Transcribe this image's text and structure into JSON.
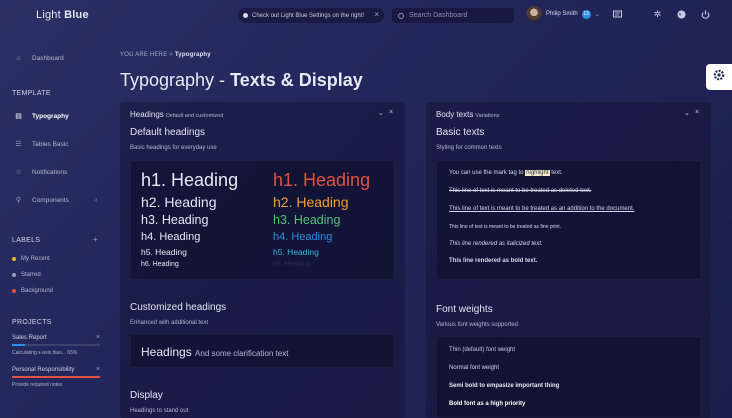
{
  "app": {
    "logo_light": "Light",
    "logo_bold": "Blue"
  },
  "topbar": {
    "notice": "Check out Light Blue Settings on the right!",
    "search_placeholder": "Search Dashboard",
    "user_name": "Philip Smith",
    "notification_count": "13"
  },
  "sidebar": {
    "items": [
      {
        "label": "Dashboard",
        "icon": "home-icon"
      },
      {
        "label": "Typography",
        "icon": "document-icon"
      },
      {
        "label": "Tables Basic",
        "icon": "grid-icon"
      },
      {
        "label": "Notifications",
        "icon": "star-icon"
      },
      {
        "label": "Components",
        "icon": "wand-icon"
      }
    ],
    "template_title": "TEMPLATE",
    "labels_title": "LABELS",
    "labels": [
      {
        "label": "My Recent",
        "color": "#f0b429"
      },
      {
        "label": "Starred",
        "color": "#9aa0bf"
      },
      {
        "label": "Background",
        "color": "#e0523f"
      }
    ],
    "projects_title": "PROJECTS",
    "projects": [
      {
        "title": "Sales Report",
        "subtitle": "Calculating x-axis bias... 65%",
        "progress": 0.15,
        "color": "#2c8ee6"
      },
      {
        "title": "Personal Responsibility",
        "subtitle": "Provide required notes",
        "progress": 1.0,
        "color": "#e0523f"
      }
    ]
  },
  "breadcrumb": {
    "prefix": "YOU ARE HERE",
    "separator": ">",
    "current": "Typography"
  },
  "page": {
    "title_light": "Typography -",
    "title_bold": "Texts & Display"
  },
  "headings_card": {
    "title": "Headings",
    "title_small": "Default and customized",
    "default_title": "Default headings",
    "default_desc": "Basic headings for everyday use",
    "left_headings": [
      "h1. Heading",
      "h2. Heading",
      "h3. Heading",
      "h4. Heading",
      "h5. Heading",
      "h6. Heading"
    ],
    "right_headings": [
      "h1. Heading",
      "h2. Heading",
      "h3. Heading",
      "h4. Heading",
      "h5. Heading",
      "h6. Heading"
    ],
    "right_colors": [
      "#e0523f",
      "#f0a030",
      "#4fc37a",
      "#2c8ee6",
      "#39b8d8",
      "#2a2d5c"
    ],
    "custom_title": "Customized headings",
    "custom_desc": "Enhanced with additional text",
    "custom_heading": "Headings",
    "custom_small": "And some clarification text",
    "display_title": "Display",
    "display_desc": "Headings to stand out"
  },
  "body_card": {
    "title": "Body texts",
    "title_small": "Variations",
    "basic_title": "Basic texts",
    "basic_desc": "Styling for common texts",
    "mark_before": "You can use the mark tag to",
    "mark_word": "highlight",
    "mark_after": "text.",
    "deleted": "This line of text is meant to be treated as deleted text.",
    "added": "This line of text is meant to be treated as an addition to the document.",
    "fine": "This line of text is meant to be treated as fine print.",
    "italic": "This line rendered as italicized text.",
    "bold": "This line rendered as bold text.",
    "weights_title": "Font weights",
    "weights_desc": "Various font weights supported",
    "weights": [
      "Thin (default) font weight",
      "Normal font weight",
      "Semi bold to empasize important thing",
      "Bold font as a high priority"
    ]
  },
  "colors": {
    "accent": "#2c8ee6",
    "danger": "#e0523f"
  }
}
